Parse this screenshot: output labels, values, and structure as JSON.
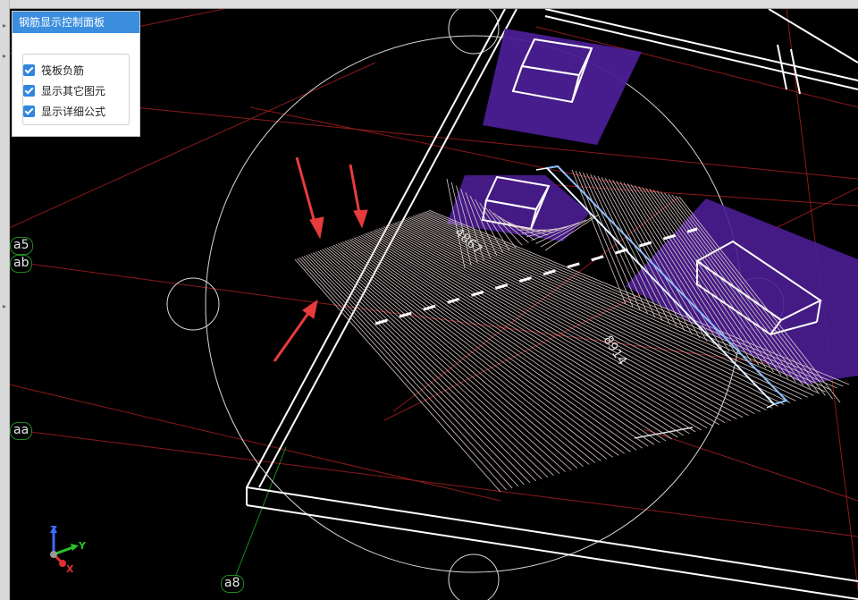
{
  "panel": {
    "title": "钢筋显示控制面板",
    "options": [
      {
        "label": "筏板负筋",
        "checked": true
      },
      {
        "label": "显示其它图元",
        "checked": true
      },
      {
        "label": "显示详细公式",
        "checked": true
      }
    ]
  },
  "axes": {
    "a5": "a5",
    "ab": "ab",
    "aa": "aa",
    "a8": "a8"
  },
  "dimensions": {
    "d1": "4867",
    "d2": "8914"
  },
  "triad": {
    "z": "Z",
    "y": "Y",
    "x": "X"
  },
  "colors": {
    "background": "#000000",
    "gridline": "#8b1a1a",
    "slab_edge": "#ffffff",
    "rebar": "#d9c8c8",
    "column": "#4a1f8a",
    "highlight_bar": "#8ec0ff",
    "arrow": "#e83b3b",
    "panel_title": "#3b8ede"
  }
}
